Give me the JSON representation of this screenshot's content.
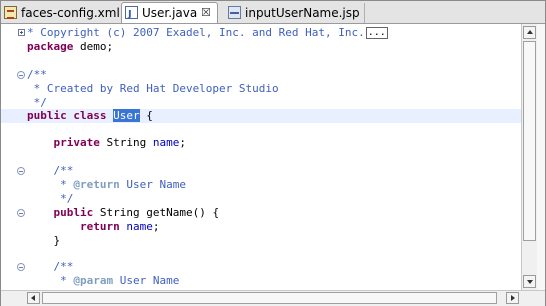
{
  "tabs": [
    {
      "label": "faces-config.xml",
      "icon": "xml-file-icon"
    },
    {
      "label": "User.java",
      "icon": "java-file-icon",
      "active": true,
      "close": "☒"
    },
    {
      "label": "inputUserName.jsp",
      "icon": "jsp-file-icon"
    }
  ],
  "code": {
    "l1": {
      "cm": "* Copyright (c) 2007 Exadel, Inc. and Red Hat, Inc.",
      "more": "..."
    },
    "l2": {
      "kw": "package",
      "rest": " demo;"
    },
    "l4": {
      "cm": "/**"
    },
    "l5": {
      "cm": " * Created by Red Hat Developer Studio"
    },
    "l6": {
      "cm": " */"
    },
    "l7": {
      "kw": "public class",
      "sel": "User",
      "rest": " {"
    },
    "l9": {
      "kw": "private",
      "rest": " String ",
      "fld": "name",
      "end": ";"
    },
    "l11": {
      "cm": "/**"
    },
    "l12": {
      "cm1": " * ",
      "jd": "@return",
      "cm2": " User Name"
    },
    "l13": {
      "cm": " */"
    },
    "l14": {
      "kw": "public",
      "rest": " String getName() {"
    },
    "l15": {
      "kw": "return",
      "fld": "name",
      "end": ";"
    },
    "l16": {
      "rest": "}"
    },
    "l18": {
      "cm": "/**"
    },
    "l19": {
      "cm1": " * ",
      "jd": "@param",
      "cm2": " User Name"
    },
    "l20": {
      "cm": " */"
    }
  },
  "colors": {
    "keyword": "#7f0055",
    "comment": "#3f5fbf",
    "javadoc_tag": "#7f9fbf",
    "field": "#0000c0",
    "selection": "#3875d7",
    "current_line": "#e8f0ff"
  }
}
